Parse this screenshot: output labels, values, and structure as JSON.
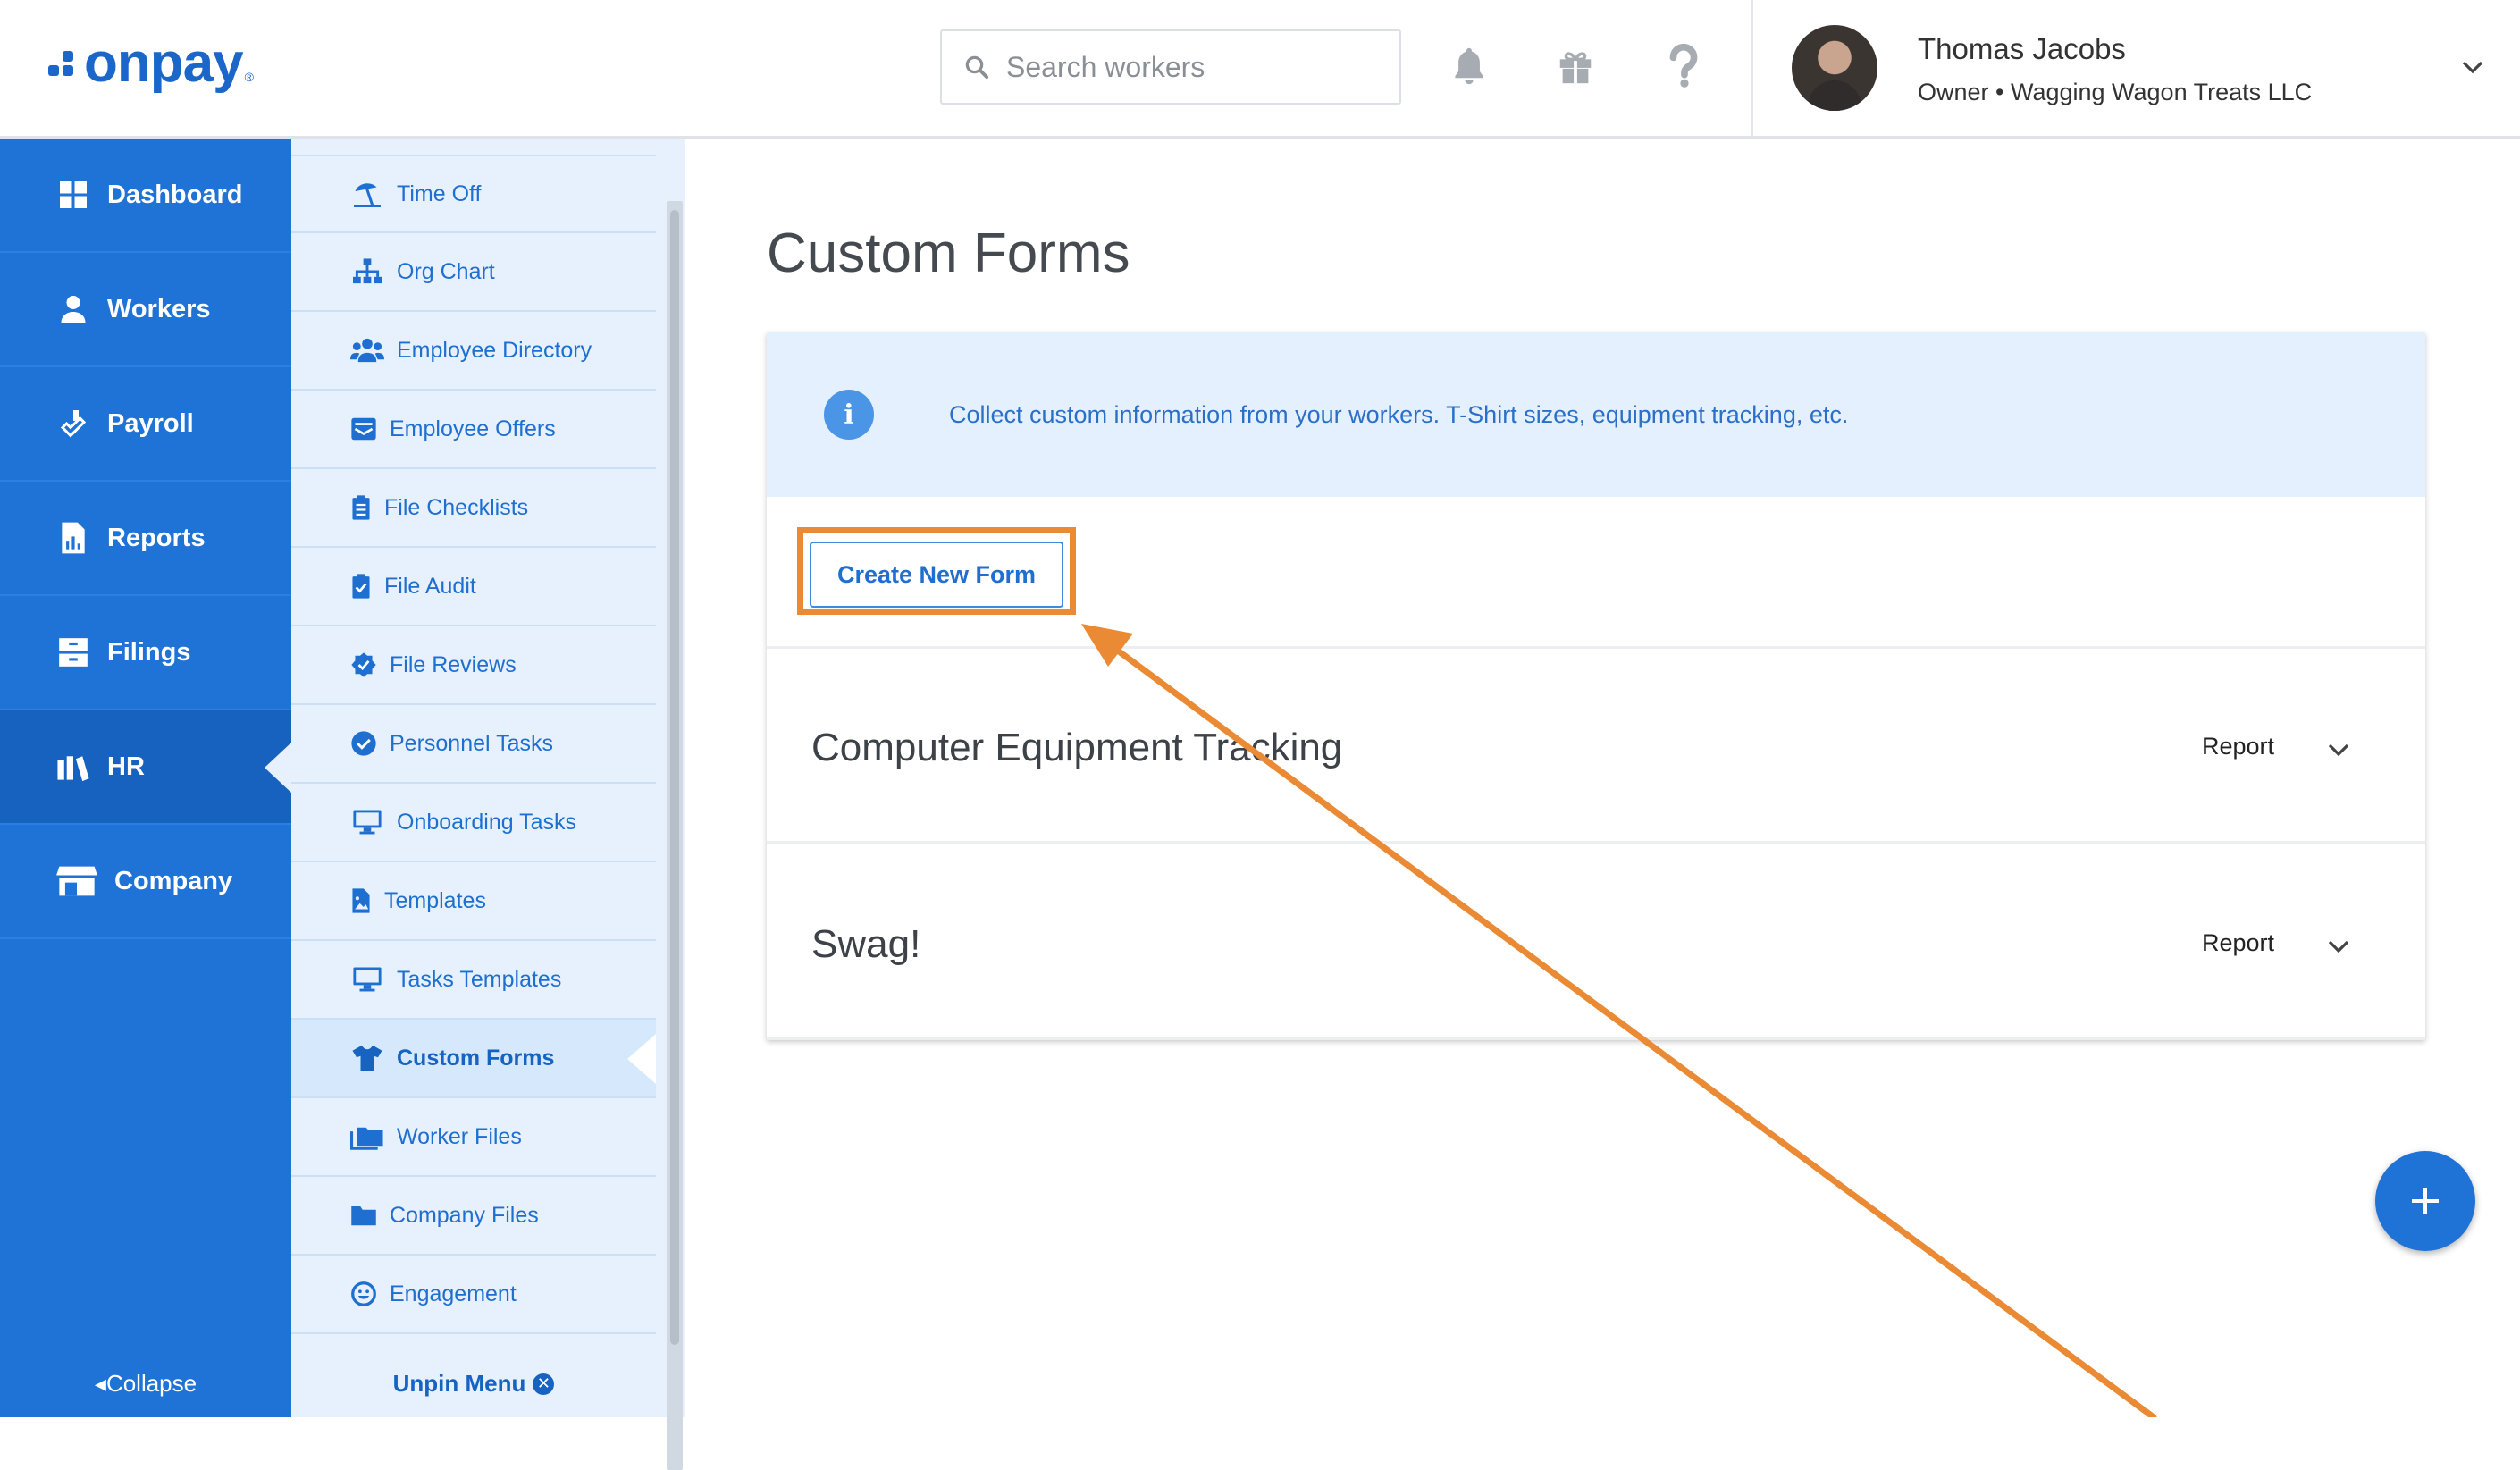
{
  "brand": {
    "logo_text": "onpay",
    "logo_mark": "®",
    "primary_color": "#1f72d6",
    "accent_color": "#ea8a34"
  },
  "header": {
    "search": {
      "placeholder": "Search workers",
      "icon": "search-icon"
    },
    "icons": [
      "bell-icon",
      "gift-icon",
      "help-icon"
    ],
    "user": {
      "name": "Thomas Jacobs",
      "role": "Owner • Wagging Wagon Treats LLC"
    }
  },
  "sidebar": {
    "items": [
      {
        "label": "Dashboard",
        "icon": "dashboard-icon",
        "active": false
      },
      {
        "label": "Workers",
        "icon": "workers-icon",
        "active": false
      },
      {
        "label": "Payroll",
        "icon": "payroll-icon",
        "active": false
      },
      {
        "label": "Reports",
        "icon": "reports-icon",
        "active": false
      },
      {
        "label": "Filings",
        "icon": "filings-icon",
        "active": false
      },
      {
        "label": "HR",
        "icon": "hr-icon",
        "active": true
      },
      {
        "label": "Company",
        "icon": "company-icon",
        "active": false
      }
    ],
    "collapse_label": "Collapse"
  },
  "submenu": {
    "items": [
      {
        "label": "Time Off",
        "icon": "beach-umbrella-icon"
      },
      {
        "label": "Org Chart",
        "icon": "org-chart-icon"
      },
      {
        "label": "Employee Directory",
        "icon": "users-icon"
      },
      {
        "label": "Employee Offers",
        "icon": "offer-letter-icon"
      },
      {
        "label": "File Checklists",
        "icon": "clipboard-list-icon"
      },
      {
        "label": "File Audit",
        "icon": "clipboard-check-icon"
      },
      {
        "label": "File Reviews",
        "icon": "badge-check-icon"
      },
      {
        "label": "Personnel Tasks",
        "icon": "check-circle-icon"
      },
      {
        "label": "Onboarding Tasks",
        "icon": "monitor-icon"
      },
      {
        "label": "Templates",
        "icon": "file-image-icon"
      },
      {
        "label": "Tasks Templates",
        "icon": "monitor-icon"
      },
      {
        "label": "Custom Forms",
        "icon": "tshirt-icon",
        "active": true
      },
      {
        "label": "Worker Files",
        "icon": "folders-icon"
      },
      {
        "label": "Company Files",
        "icon": "folder-icon"
      },
      {
        "label": "Engagement",
        "icon": "smile-icon"
      }
    ],
    "unpin_label": "Unpin Menu"
  },
  "main": {
    "title": "Custom Forms",
    "info_text": "Collect custom information from your workers. T-Shirt sizes, equipment tracking, etc.",
    "create_button": "Create New Form",
    "forms": [
      {
        "name": "Computer Equipment Tracking",
        "action": "Report"
      },
      {
        "name": "Swag!",
        "action": "Report"
      }
    ]
  }
}
